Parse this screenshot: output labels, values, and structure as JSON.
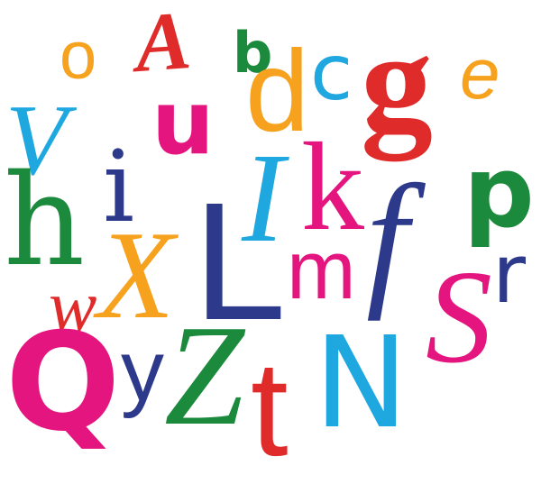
{
  "letters": {
    "o": {
      "char": "o",
      "color": "#F6A21E"
    },
    "A": {
      "char": "A",
      "color": "#E02B2B"
    },
    "b": {
      "char": "b",
      "color": "#1B8A3C"
    },
    "d": {
      "char": "d",
      "color": "#F6A21E"
    },
    "c": {
      "char": "c",
      "color": "#1FA8E0"
    },
    "g": {
      "char": "g",
      "color": "#E02B2B"
    },
    "e": {
      "char": "e",
      "color": "#F6A21E"
    },
    "V": {
      "char": "V",
      "color": "#1FA8E0"
    },
    "u": {
      "char": "u",
      "color": "#E5157F"
    },
    "h": {
      "char": "h",
      "color": "#1B8A3C"
    },
    "i": {
      "char": "i",
      "color": "#2D3A8C"
    },
    "I": {
      "char": "I",
      "color": "#1FA8E0"
    },
    "k": {
      "char": "k",
      "color": "#E5157F"
    },
    "f": {
      "char": "f",
      "color": "#2D3A8C"
    },
    "p": {
      "char": "p",
      "color": "#1B8A3C"
    },
    "w": {
      "char": "w",
      "color": "#E02B2B"
    },
    "X": {
      "char": "X",
      "color": "#F6A21E"
    },
    "L": {
      "char": "L",
      "color": "#2D3A8C"
    },
    "m": {
      "char": "m",
      "color": "#E5157F"
    },
    "r": {
      "char": "r",
      "color": "#2D3A8C"
    },
    "S": {
      "char": "S",
      "color": "#E5157F"
    },
    "Q": {
      "char": "Q",
      "color": "#E5157F"
    },
    "y": {
      "char": "y",
      "color": "#2D3A8C"
    },
    "Z": {
      "char": "Z",
      "color": "#1B8A3C"
    },
    "t": {
      "char": "t",
      "color": "#E02B2B"
    },
    "N": {
      "char": "N",
      "color": "#1FA8E0"
    }
  }
}
